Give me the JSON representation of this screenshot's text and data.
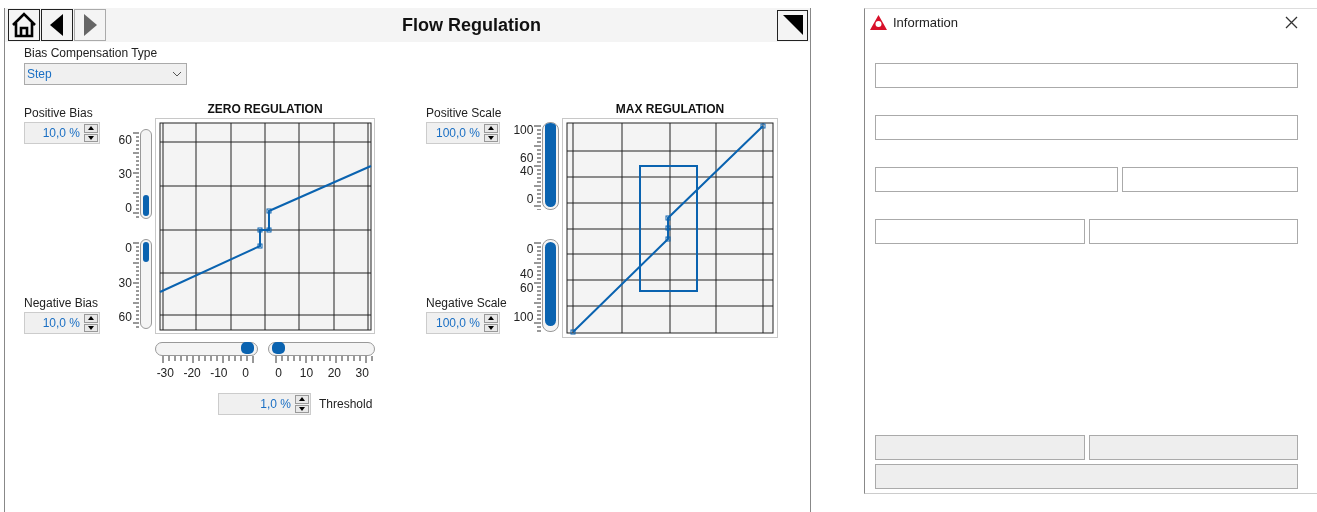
{
  "header": {
    "title": "Flow Regulation",
    "nav": [
      {
        "kind": "home",
        "disabled": false
      },
      {
        "kind": "back",
        "disabled": false
      },
      {
        "kind": "forward",
        "disabled": true
      }
    ],
    "corner": {
      "kind": "corner"
    }
  },
  "bias_compensation": {
    "label": "Bias Compensation Type",
    "value": "Step"
  },
  "regulations": [
    {
      "title": "ZERO REGULATION",
      "positive": {
        "label": "Positive Bias",
        "value": "10,0 %"
      },
      "negative": {
        "label": "Negative Bias",
        "value": "10,0 %"
      },
      "vertical_sliders": [
        {
          "kind": "up",
          "level": 0.24,
          "ticks": [
            "60",
            "30",
            "0"
          ]
        },
        {
          "kind": "down",
          "level": 0.23,
          "ticks": [
            "0",
            "30",
            "60"
          ]
        }
      ],
      "horizontal_sliders": [
        {
          "level": 0.97,
          "ticks": [
            "-30",
            "-20",
            "-10",
            "0"
          ]
        },
        {
          "level": 0.03,
          "ticks": [
            "0",
            "10",
            "20",
            "30"
          ]
        }
      ],
      "threshold": {
        "label": "Threshold",
        "value": "1,0 %"
      }
    },
    {
      "title": "MAX REGULATION",
      "positive": {
        "label": "Positive Scale",
        "value": "100,0 %"
      },
      "negative": {
        "label": "Negative Scale",
        "value": "100,0 %"
      },
      "vertical_sliders": [
        {
          "kind": "up",
          "level": 1,
          "ticks": [
            "100",
            "60",
            "40",
            "0"
          ]
        },
        {
          "kind": "down",
          "level": 0.92,
          "ticks": [
            "0",
            "40",
            "60",
            "100"
          ]
        }
      ]
    }
  ],
  "information": {
    "title": "Information",
    "field_rows": [
      {
        "kind": "wide"
      },
      {
        "kind": "wide"
      },
      {
        "kind": "left-wide"
      },
      {
        "kind": "pair"
      }
    ],
    "button_rows": [
      {
        "kind": "pair"
      },
      {
        "kind": "wide"
      }
    ]
  }
}
